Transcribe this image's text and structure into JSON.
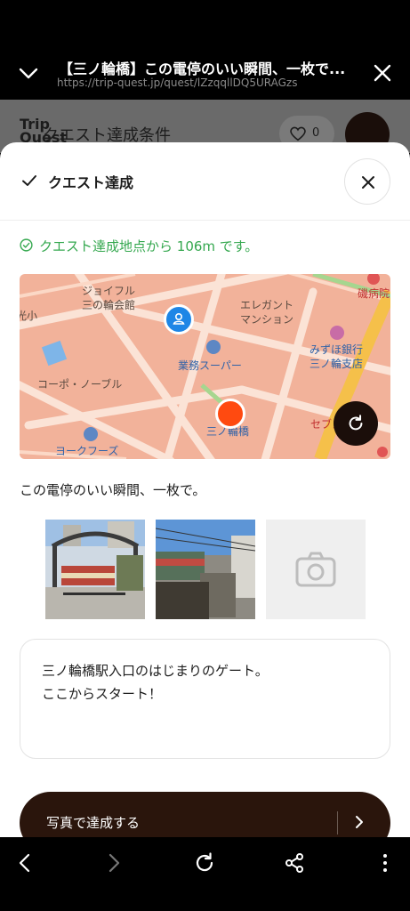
{
  "browser": {
    "title": "【三ノ輪橋】この電停のいい瞬間、一枚で...",
    "url": "https://trip-quest.jp/quest/lZzqqllDQ5URAGzs"
  },
  "background_page": {
    "logo": "Trip Quest",
    "title": "クエスト達成条件",
    "favorite_count": "0"
  },
  "sheet": {
    "header_label": "クエスト達成",
    "status_text": "クエスト達成地点から 106m です。",
    "map": {
      "labels": {
        "jyoiful": "ジョイフル",
        "jyoiful2": "三の輪会館",
        "elegant": "エレガント",
        "elegant2": "マンション",
        "mizuho": "みずほ銀行",
        "mizuho2": "三ノ輪支店",
        "gyomu": "業務スーパー",
        "corpo": "コーポ・ノーブル",
        "minowa": "三ノ輪橋",
        "yorkfoods": "ヨークフーズ",
        "hospital": "磯病院",
        "seven": "セブン",
        "koko": "光小"
      }
    },
    "description": "この電停のいい瞬間、一枚で。",
    "comment_lines": [
      "三ノ輪橋駅入口のはじまりのゲート。",
      "ここからスタート！"
    ],
    "submit_label": "写真で達成する"
  },
  "icons": {
    "back": "chevron-down-icon",
    "close": "close-icon",
    "check": "check-icon",
    "status": "check-circle-icon",
    "user_pin": "user-location-icon",
    "refresh": "refresh-icon",
    "camera": "camera-icon",
    "arrow": "chevron-right-icon"
  },
  "colors": {
    "accent_dark": "#2a150c",
    "success": "#35a84f",
    "user_pin": "#1e86e6",
    "target_pin": "#ff4a10",
    "map_bg": "#f2b29a"
  }
}
